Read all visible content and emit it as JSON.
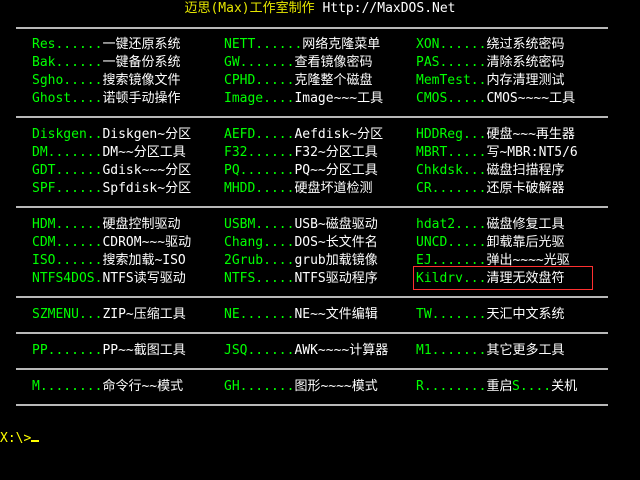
{
  "title": {
    "brand": "迈思(Max)工作室制作",
    "url": "Http://MaxDOS.Net"
  },
  "rows": [
    [
      "Res......",
      "一键还原系统",
      "NETT......",
      "网络克隆菜单",
      "XON......",
      "绕过系统密码"
    ],
    [
      "Bak......",
      "一键备份系统",
      "GW.......",
      "查看镜像密码",
      "PAS......",
      "清除系统密码"
    ],
    [
      "Sgho.....",
      "搜索镜像文件",
      "CPHD.....",
      "克隆整个磁盘",
      "MemTest..",
      "内存清理测试"
    ],
    [
      "Ghost....",
      "诺顿手动操作",
      "Image....",
      "Image~~~工具",
      "CMOS.....",
      "CMOS~~~~工具"
    ],
    [
      "Diskgen..",
      "Diskgen~分区",
      "AEFD.....",
      "Aefdisk~分区",
      "HDDReg...",
      "硬盘~~~再生器"
    ],
    [
      "DM.......",
      "DM~~分区工具",
      "F32......",
      "F32~分区工具",
      "MBRT.....",
      "写~MBR:NT5/6"
    ],
    [
      "GDT......",
      "Gdisk~~~分区",
      "PQ.......",
      "PQ~~分区工具",
      "Chkdsk...",
      "磁盘扫描程序"
    ],
    [
      "SPF......",
      "Spfdisk~分区",
      "MHDD.....",
      "硬盘坏道检测",
      "CR.......",
      "还原卡破解器"
    ],
    [
      "HDM......",
      "硬盘控制驱动",
      "USBM.....",
      "USB~磁盘驱动",
      "hdat2....",
      "磁盘修复工具"
    ],
    [
      "CDM......",
      "CDROM~~~驱动",
      "Chang....",
      "DOS~长文件名",
      "UNCD.....",
      "卸载靠后光驱"
    ],
    [
      "ISO......",
      "搜索加载~ISO",
      "2Grub....",
      "grub加载镜像",
      "EJ.......",
      "弹出~~~~光驱"
    ],
    [
      "NTFS4DOS.",
      "NTFS读写驱动",
      "NTFS.....",
      "NTFS驱动程序",
      "Kildrv...",
      "清理无效盘符"
    ],
    [
      "SZMENU...",
      "ZIP~压缩工具",
      "NE.......",
      "NE~~文件编辑",
      "TW.......",
      "天汇中文系统"
    ],
    [
      "PP.......",
      "PP~~截图工具",
      "JSQ......",
      "AWK~~~~计算器",
      "M1.......",
      "其它更多工具"
    ],
    [
      "M........",
      "命令行~~模式",
      "GH.......",
      "图形~~~~模式",
      "R........",
      "重启"
    ]
  ],
  "extra": {
    "key": "S....",
    "desc": "关机"
  },
  "prompt": "X:\\>"
}
